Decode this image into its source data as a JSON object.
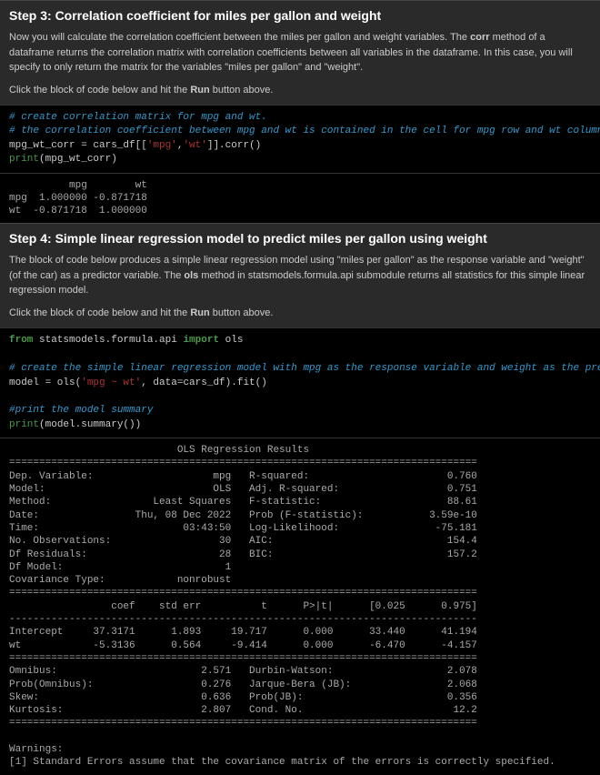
{
  "step3": {
    "title": "Step 3: Correlation coefficient for miles per gallon and weight",
    "description_parts": {
      "p1": "Now you will calculate the correlation coefficient between the miles per gallon and weight variables. The ",
      "p2": " method of a dataframe returns the correlation matrix with correlation coefficients between all variables in the dataframe. In this case, you will specify to only return the matrix for the variables \"miles per gallon\" and \"weight\"."
    },
    "corr_label": "corr",
    "instruction_parts": {
      "p1": "Click the block of code below and hit the ",
      "p2": " button above."
    },
    "run_label": "Run",
    "code": {
      "c1": "# create correlation matrix for mpg and wt.",
      "c2": "# the correlation coefficient between mpg and wt is contained in the cell for mpg row and wt column (or wt row and mpg column)",
      "l1a": "mpg_wt_corr = cars_df[[",
      "s1": "'mpg'",
      "l1b": ",",
      "s2": "'wt'",
      "l1c": "]].corr()",
      "l2a": "print",
      "l2b": "(mpg_wt_corr)"
    },
    "output": "          mpg        wt\nmpg  1.000000 -0.871718\nwt  -0.871718  1.000000"
  },
  "step4": {
    "title": "Step 4: Simple linear regression model to predict miles per gallon using weight",
    "description_parts": {
      "p1": "The block of code below produces a simple linear regression model using \"miles per gallon\" as the response variable and \"weight\" (of the car) as a predictor variable. The ",
      "p2": " method in statsmodels.formula.api submodule returns all statistics for this simple linear regression model."
    },
    "ols_label": "ols",
    "instruction_parts": {
      "p1": "Click the block of code below and hit the ",
      "p2": " button above."
    },
    "run_label": "Run",
    "code": {
      "k1": "from",
      "m1": " statsmodels.formula.api ",
      "k2": "import",
      "m2": " ols",
      "c1": "# create the simple linear regression model with mpg as the response variable and weight as the predictor variable",
      "l1a": "model = ols(",
      "s1": "'mpg ~ wt'",
      "l1b": ", data=cars_df).fit()",
      "c2": "#print the model summary",
      "l2a": "print",
      "l2b": "(model.summary())"
    },
    "output": "                            OLS Regression Results                            \n==============================================================================\nDep. Variable:                    mpg   R-squared:                       0.760\nModel:                            OLS   Adj. R-squared:                  0.751\nMethod:                 Least Squares   F-statistic:                     88.61\nDate:                Thu, 08 Dec 2022   Prob (F-statistic):           3.59e-10\nTime:                        03:43:50   Log-Likelihood:                -75.181\nNo. Observations:                  30   AIC:                             154.4\nDf Residuals:                      28   BIC:                             157.2\nDf Model:                           1                                         \nCovariance Type:            nonrobust                                         \n==============================================================================\n                 coef    std err          t      P>|t|      [0.025      0.975]\n------------------------------------------------------------------------------\nIntercept     37.3171      1.893     19.717      0.000      33.440      41.194\nwt            -5.3136      0.564     -9.414      0.000      -6.470      -4.157\n==============================================================================\nOmnibus:                        2.571   Durbin-Watson:                   2.078\nProb(Omnibus):                  0.276   Jarque-Bera (JB):                2.068\nSkew:                           0.636   Prob(JB):                        0.356\nKurtosis:                       2.807   Cond. No.                         12.2\n==============================================================================\n\nWarnings:\n[1] Standard Errors assume that the covariance matrix of the errors is correctly specified."
  }
}
